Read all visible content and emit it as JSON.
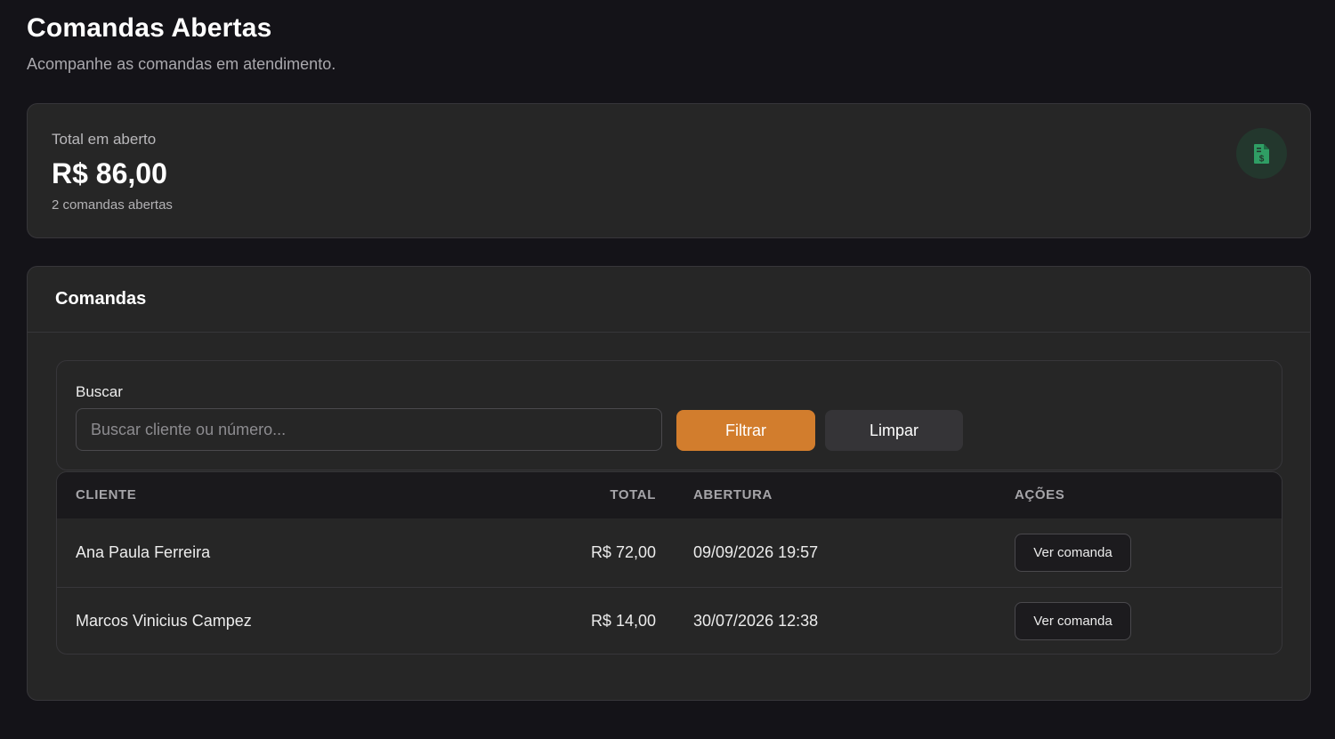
{
  "header": {
    "title": "Comandas Abertas",
    "subtitle": "Acompanhe as comandas em atendimento."
  },
  "summary": {
    "label": "Total em aberto",
    "value": "R$ 86,00",
    "count_text": "2 comandas abertas",
    "icon": "invoice-dollar-icon",
    "icon_color": "#2f9e64"
  },
  "list": {
    "title": "Comandas",
    "search": {
      "label": "Buscar",
      "placeholder": "Buscar cliente ou número...",
      "value": ""
    },
    "filter_button": "Filtrar",
    "clear_button": "Limpar",
    "accent_color": "#d27d2d",
    "columns": [
      "CLIENTE",
      "TOTAL",
      "ABERTURA",
      "AÇÕES"
    ],
    "rows": [
      {
        "cliente": "Ana Paula Ferreira",
        "total": "R$ 72,00",
        "abertura": "09/09/2026 19:57",
        "action": "Ver comanda"
      },
      {
        "cliente": "Marcos Vinicius Campez",
        "total": "R$ 14,00",
        "abertura": "30/07/2026 12:38",
        "action": "Ver comanda"
      }
    ]
  }
}
